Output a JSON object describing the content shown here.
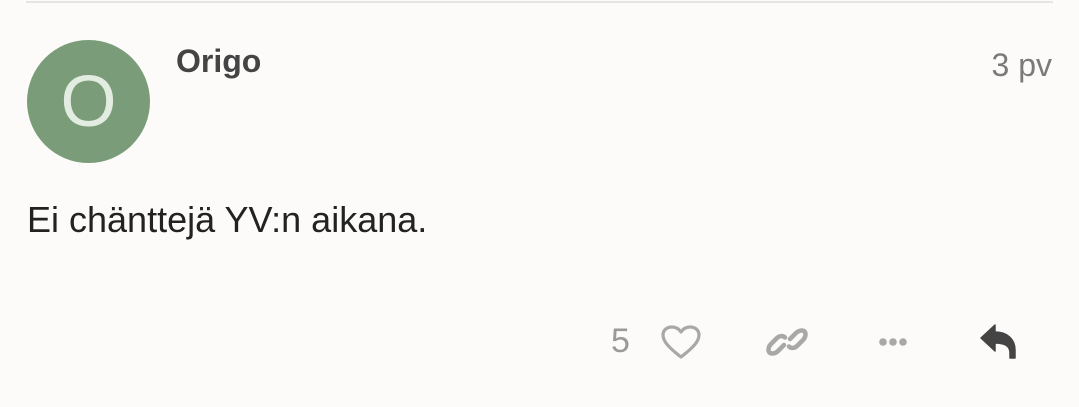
{
  "post": {
    "avatar_letter": "O",
    "username": "Origo",
    "date": "3 pv",
    "body": "Ei chänttejä YV:n aikana."
  },
  "actions": {
    "like_count": "5",
    "icons": [
      "heart-icon",
      "link-icon",
      "more-icon",
      "reply-icon"
    ]
  },
  "colors": {
    "background": "#fcfbf9",
    "avatar": "#7a9c78",
    "icon_muted": "#a8a8a8",
    "icon_dark": "#444444"
  }
}
